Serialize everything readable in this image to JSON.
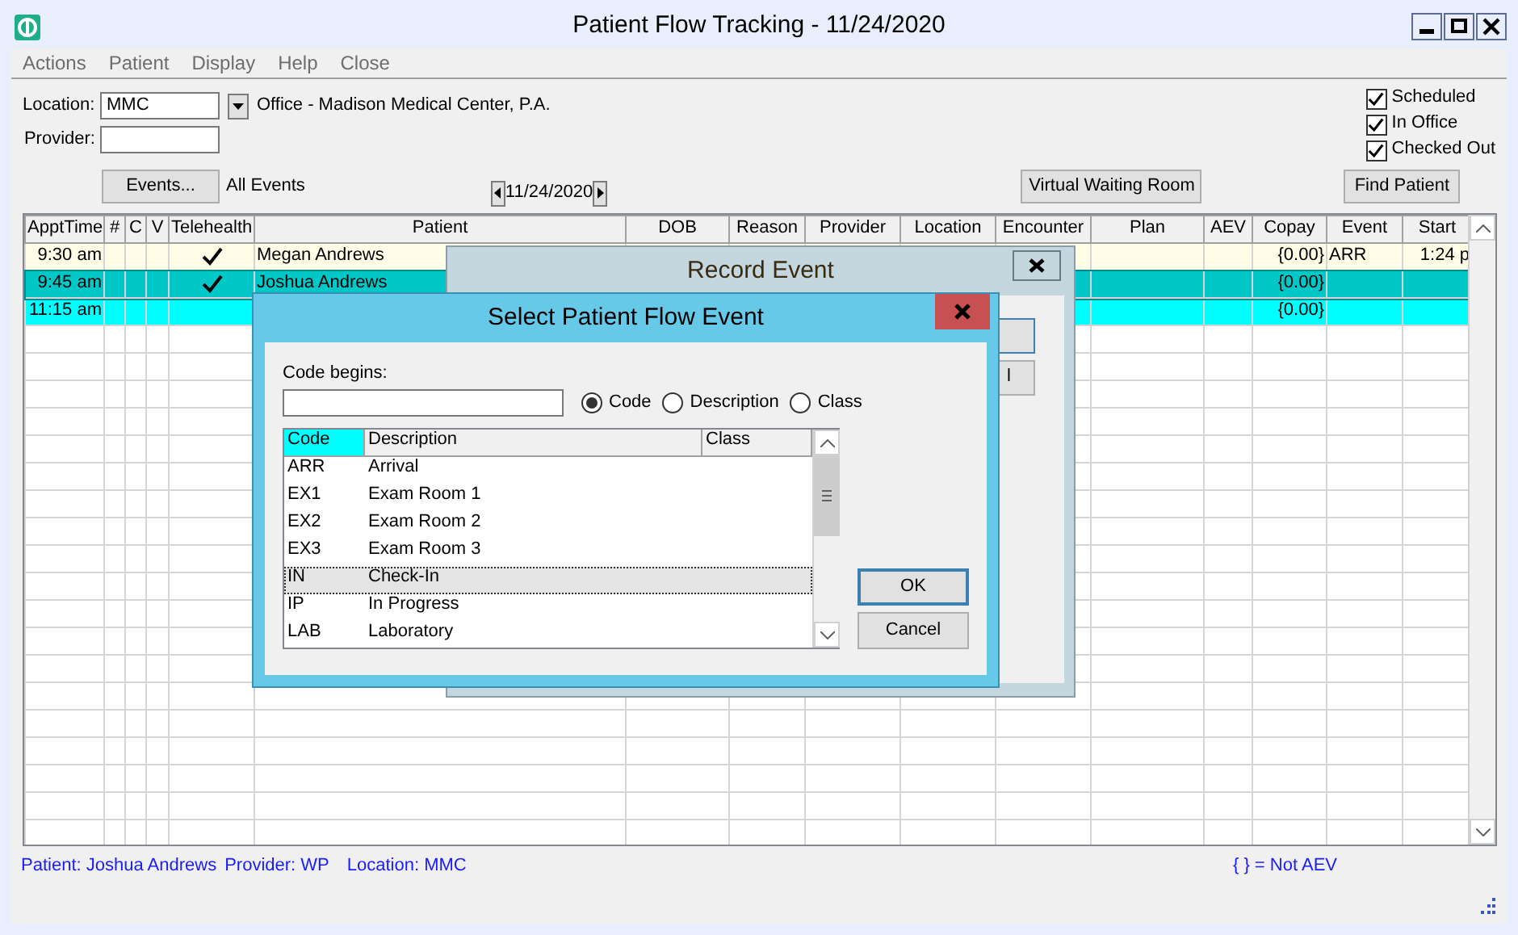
{
  "window": {
    "title": "Patient Flow Tracking - 11/24/2020"
  },
  "menu": [
    {
      "label": "Actions",
      "disabled": true
    },
    {
      "label": "Patient",
      "disabled": true
    },
    {
      "label": "Display",
      "disabled": true
    },
    {
      "label": "Help",
      "disabled": true
    },
    {
      "label": "Close",
      "disabled": true
    }
  ],
  "filters": {
    "location_label": "Location:",
    "location": "MMC",
    "location_name": "Office - Madison Medical Center, P.A.",
    "provider_label": "Provider:"
  },
  "status_filters": [
    {
      "label": "Scheduled",
      "checked": true
    },
    {
      "label": "In Office",
      "checked": true
    },
    {
      "label": "Checked Out",
      "checked": true
    }
  ],
  "events_button": "Events...",
  "events_filter": "All Events",
  "date": "11/24/2020",
  "buttons": [
    "Virtual Waiting Room",
    "Find Patient"
  ],
  "grid": {
    "columns": [
      "ApptTime",
      "#",
      "C",
      "V",
      "Telehealth",
      "Patient",
      "DOB",
      "Reason",
      "Provider",
      "Location",
      "Encounter",
      "Plan",
      "AEV",
      "Copay",
      "Event",
      "Start"
    ],
    "rows": [
      {
        "appt_time": "9:30 am",
        "telehealth": true,
        "patient": "Megan Andrews",
        "copay": "{0.00}",
        "event": "ARR",
        "start": "1:24 p",
        "selected": false,
        "color": "#fffde6"
      },
      {
        "appt_time": "9:45 am",
        "telehealth": true,
        "patient": "Joshua Andrews",
        "copay": "{0.00}",
        "selected": true,
        "color": "#00c8c8"
      },
      {
        "appt_time": "11:15 am",
        "telehealth": false,
        "copay": "{0.00}",
        "selected": false,
        "color": "#00ffff"
      }
    ]
  },
  "status_bar": {
    "left": [
      "Patient: Joshua Andrews",
      "Provider: WP",
      "Location: MMC"
    ],
    "right": "{ } = Not AEV"
  },
  "record_event": {
    "title": "Record Event",
    "button_fragment": "l"
  },
  "select_event": {
    "title": "Select Patient Flow Event",
    "code_label": "Code begins:",
    "search_by": [
      {
        "label": "Code",
        "selected": true
      },
      {
        "label": "Description",
        "selected": false
      },
      {
        "label": "Class",
        "selected": false
      }
    ],
    "list": {
      "columns": [
        {
          "label": "Code",
          "selected": true
        },
        {
          "label": "Description",
          "selected": false
        },
        {
          "label": "Class",
          "selected": false
        }
      ],
      "rows": [
        {
          "code": "ARR",
          "description": "Arrival",
          "selected": false
        },
        {
          "code": "EX1",
          "description": "Exam Room 1",
          "selected": false
        },
        {
          "code": "EX2",
          "description": "Exam Room 2",
          "selected": false
        },
        {
          "code": "EX3",
          "description": "Exam Room 3",
          "selected": false
        },
        {
          "code": "IN",
          "description": "Check-In",
          "selected": true
        },
        {
          "code": "IP",
          "description": "In Progress",
          "selected": false
        },
        {
          "code": "LAB",
          "description": "Laboratory",
          "selected": false
        }
      ]
    },
    "buttons": [
      {
        "label": "OK",
        "default": true
      },
      {
        "label": "Cancel",
        "default": false
      }
    ]
  }
}
